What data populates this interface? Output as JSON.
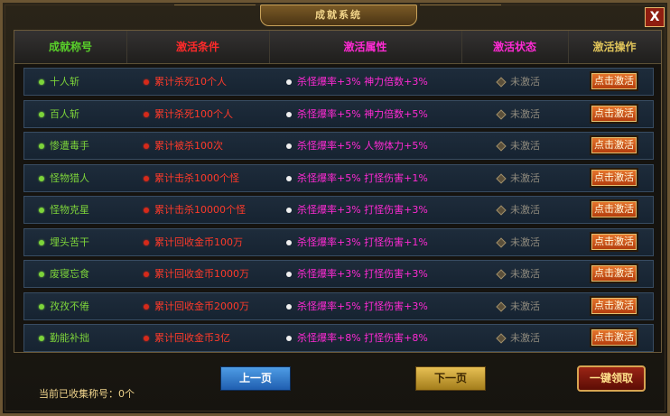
{
  "window": {
    "title": "成就系统",
    "close_label": "X"
  },
  "table": {
    "columns": [
      "成就称号",
      "激活条件",
      "激活属性",
      "激活状态",
      "激活操作"
    ],
    "column_colors": [
      "#59d12a",
      "#ff2a2a",
      "#ff2ad4",
      "#ff2ad4",
      "#e0c45a"
    ],
    "rows": [
      {
        "title": "十人斩",
        "condition": "累计杀死10个人",
        "attr": "杀怪爆率+3% 神力倍数+3%",
        "status": "未激活",
        "action": "点击激活"
      },
      {
        "title": "百人斩",
        "condition": "累计杀死100个人",
        "attr": "杀怪爆率+5% 神力倍数+5%",
        "status": "未激活",
        "action": "点击激活"
      },
      {
        "title": "惨遭毒手",
        "condition": "累计被杀100次",
        "attr": "杀怪爆率+5% 人物体力+5%",
        "status": "未激活",
        "action": "点击激活"
      },
      {
        "title": "怪物猎人",
        "condition": "累计击杀1000个怪",
        "attr": "杀怪爆率+5% 打怪伤害+1%",
        "status": "未激活",
        "action": "点击激活"
      },
      {
        "title": "怪物克星",
        "condition": "累计击杀10000个怪",
        "attr": "杀怪爆率+3% 打怪伤害+3%",
        "status": "未激活",
        "action": "点击激活"
      },
      {
        "title": "埋头苦干",
        "condition": "累计回收金币100万",
        "attr": "杀怪爆率+3% 打怪伤害+1%",
        "status": "未激活",
        "action": "点击激活"
      },
      {
        "title": "废寝忘食",
        "condition": "累计回收金币1000万",
        "attr": "杀怪爆率+3% 打怪伤害+3%",
        "status": "未激活",
        "action": "点击激活"
      },
      {
        "title": "孜孜不倦",
        "condition": "累计回收金币2000万",
        "attr": "杀怪爆率+5% 打怪伤害+3%",
        "status": "未激活",
        "action": "点击激活"
      },
      {
        "title": "勤能补拙",
        "condition": "累计回收金币3亿",
        "attr": "杀怪爆率+8% 打怪伤害+8%",
        "status": "未激活",
        "action": "点击激活"
      }
    ]
  },
  "footer": {
    "prev_label": "上一页",
    "next_label": "下一页",
    "claim_all_label": "一键领取",
    "collected_text": "当前已收集称号：0个"
  },
  "colors": {
    "title_text": "#7dd43a",
    "condition_text": "#ff3a2a",
    "attr_text": "#ff2ad4",
    "status_text": "#8f8a7d"
  }
}
